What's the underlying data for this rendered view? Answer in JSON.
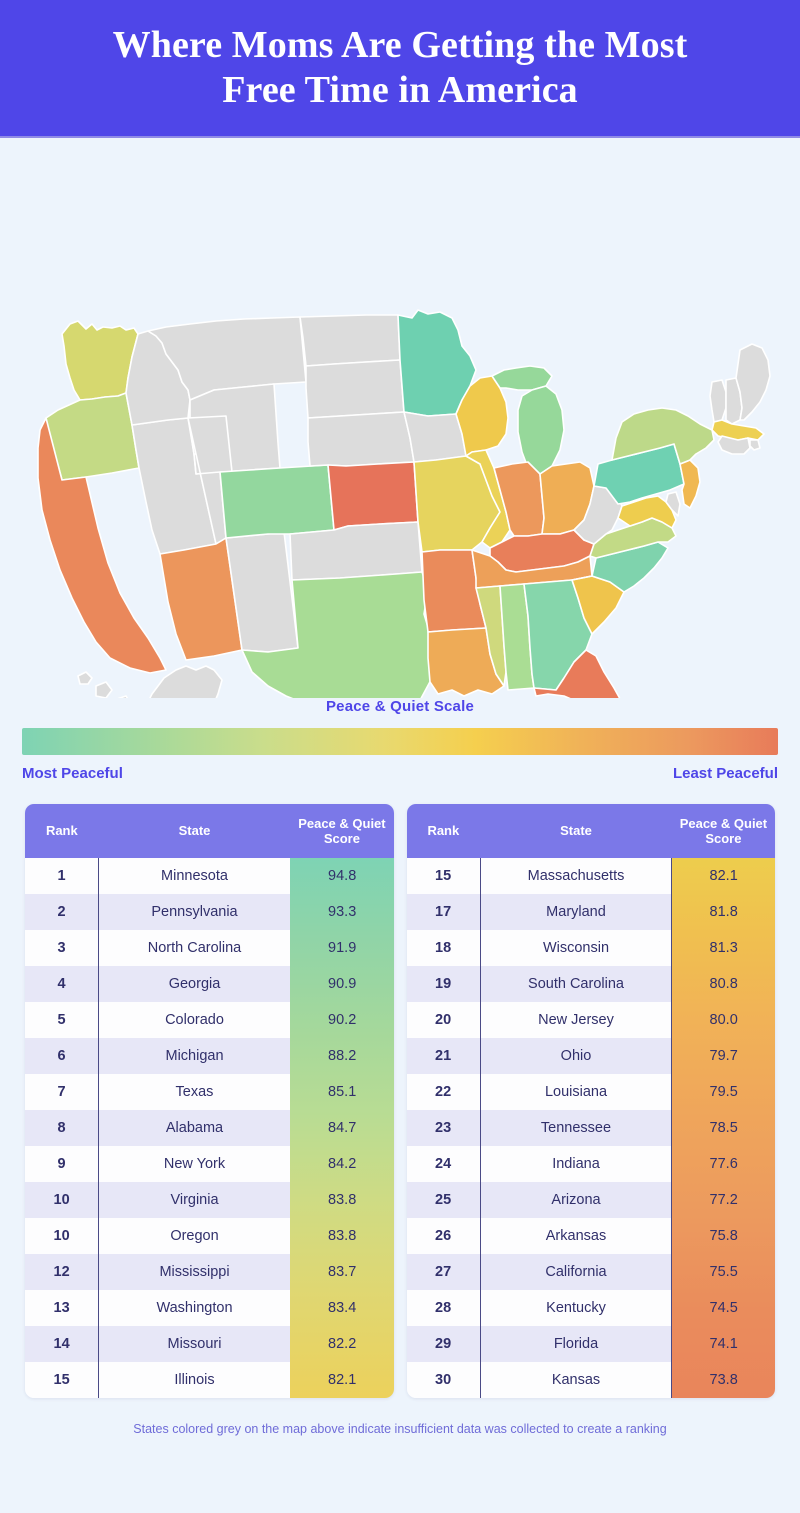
{
  "header": {
    "title": "Where Moms Are Getting the Most Free Time in America",
    "bg_color": "#4f46e8",
    "text_color": "#ffffff"
  },
  "page": {
    "background_color": "#edf4fc"
  },
  "legend": {
    "title": "Peace & Quiet Scale",
    "left_label": "Most Peaceful",
    "right_label": "Least Peaceful",
    "gradient_start": "#7ed3b4",
    "gradient_mid": "#f5cf4e",
    "gradient_end": "#e87b5a",
    "label_color": "#4f46e8"
  },
  "table_headers": {
    "rank": "Rank",
    "state": "State",
    "score": "Peace & Quiet Score",
    "header_bg": "#7b78e8"
  },
  "footnote": "States colored grey on the map above indicate insufficient data was collected to create a ranking",
  "chart_data": {
    "type": "table",
    "title": "Where Moms Are Getting the Most Free Time in America",
    "metric": "Peace & Quiet Score",
    "columns": [
      "Rank",
      "State",
      "Peace & Quiet Score"
    ],
    "no_data_color": "#dcdcdc",
    "scale": {
      "most_peaceful_color": "#7ed3b4",
      "least_peaceful_color": "#e87b5a"
    },
    "rows_left": [
      {
        "rank": "1",
        "state": "Minnesota",
        "score": "94.8"
      },
      {
        "rank": "2",
        "state": "Pennsylvania",
        "score": "93.3"
      },
      {
        "rank": "3",
        "state": "North Carolina",
        "score": "91.9"
      },
      {
        "rank": "4",
        "state": "Georgia",
        "score": "90.9"
      },
      {
        "rank": "5",
        "state": "Colorado",
        "score": "90.2"
      },
      {
        "rank": "6",
        "state": "Michigan",
        "score": "88.2"
      },
      {
        "rank": "7",
        "state": "Texas",
        "score": "85.1"
      },
      {
        "rank": "8",
        "state": "Alabama",
        "score": "84.7"
      },
      {
        "rank": "9",
        "state": "New York",
        "score": "84.2"
      },
      {
        "rank": "10",
        "state": "Virginia",
        "score": "83.8"
      },
      {
        "rank": "10",
        "state": "Oregon",
        "score": "83.8"
      },
      {
        "rank": "12",
        "state": "Mississippi",
        "score": "83.7"
      },
      {
        "rank": "13",
        "state": "Washington",
        "score": "83.4"
      },
      {
        "rank": "14",
        "state": "Missouri",
        "score": "82.2"
      },
      {
        "rank": "15",
        "state": "Illinois",
        "score": "82.1"
      }
    ],
    "rows_right": [
      {
        "rank": "15",
        "state": "Massachusetts",
        "score": "82.1"
      },
      {
        "rank": "17",
        "state": "Maryland",
        "score": "81.8"
      },
      {
        "rank": "18",
        "state": "Wisconsin",
        "score": "81.3"
      },
      {
        "rank": "19",
        "state": "South Carolina",
        "score": "80.8"
      },
      {
        "rank": "20",
        "state": "New Jersey",
        "score": "80.0"
      },
      {
        "rank": "21",
        "state": "Ohio",
        "score": "79.7"
      },
      {
        "rank": "22",
        "state": "Louisiana",
        "score": "79.5"
      },
      {
        "rank": "23",
        "state": "Tennessee",
        "score": "78.5"
      },
      {
        "rank": "24",
        "state": "Indiana",
        "score": "77.6"
      },
      {
        "rank": "25",
        "state": "Arizona",
        "score": "77.2"
      },
      {
        "rank": "26",
        "state": "Arkansas",
        "score": "75.8"
      },
      {
        "rank": "27",
        "state": "California",
        "score": "75.5"
      },
      {
        "rank": "28",
        "state": "Kentucky",
        "score": "74.5"
      },
      {
        "rank": "29",
        "state": "Florida",
        "score": "74.1"
      },
      {
        "rank": "30",
        "state": "Kansas",
        "score": "73.8"
      }
    ],
    "map_state_colors": {
      "Minnesota": "#6ed0b0",
      "Pennsylvania": "#6fd1b2",
      "North Carolina": "#7fd3ad",
      "Georgia": "#86d6ab",
      "Colorado": "#93d79e",
      "Michigan": "#96d89a",
      "Texas": "#a8dc95",
      "Alabama": "#aadd94",
      "New York": "#bdd989",
      "Virginia": "#c2da86",
      "Oregon": "#c4da85",
      "Mississippi": "#cfd97d",
      "Washington": "#d6d86f",
      "Missouri": "#e6d45e",
      "Illinois": "#ebd257",
      "Massachusetts": "#edd052",
      "Maryland": "#eecd4e",
      "Wisconsin": "#efc94c",
      "South Carolina": "#efc44c",
      "New Jersey": "#f0b851",
      "Ohio": "#efae55",
      "Louisiana": "#eeab57",
      "Tennessee": "#eda059",
      "Indiana": "#ec985c",
      "Arizona": "#ec965c",
      "Arkansas": "#ea8b5b",
      "California": "#ea885b",
      "Kentucky": "#e87f5a",
      "Florida": "#e87b5a",
      "Kansas": "#e6735a",
      "no_data": "#dcdcdc"
    }
  }
}
